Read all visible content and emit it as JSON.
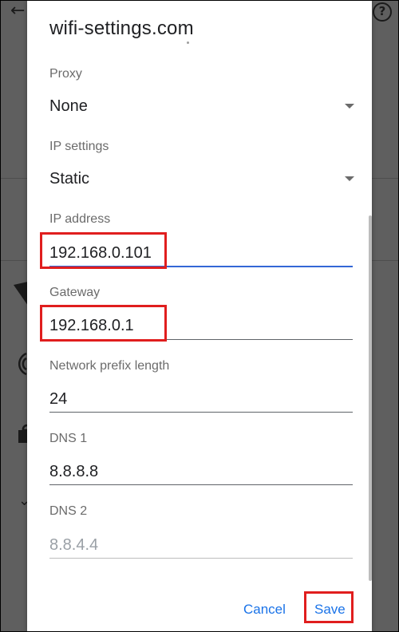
{
  "dialog": {
    "title": "wifi-settings.com",
    "fields": {
      "proxy": {
        "label": "Proxy",
        "value": "None"
      },
      "ip_settings": {
        "label": "IP settings",
        "value": "Static"
      },
      "ip_address": {
        "label": "IP address",
        "value": "192.168.0.101"
      },
      "gateway": {
        "label": "Gateway",
        "value": "192.168.0.1"
      },
      "prefix_length": {
        "label": "Network prefix length",
        "value": "24"
      },
      "dns1": {
        "label": "DNS 1",
        "value": "8.8.8.8"
      },
      "dns2": {
        "label": "DNS 2",
        "placeholder": "8.8.4.4"
      }
    },
    "buttons": {
      "cancel": "Cancel",
      "save": "Save"
    }
  },
  "colors": {
    "accent": "#1a73e8",
    "focus_underline": "#3367d6",
    "highlight_box": "#e01e1e"
  },
  "icons": {
    "back": "arrow-back-icon",
    "help": "help-icon",
    "wifi_full": "wifi-icon",
    "wifi_weak": "wifi-weak-icon",
    "lock": "lock-icon",
    "chevron": "chevron-down-icon"
  }
}
